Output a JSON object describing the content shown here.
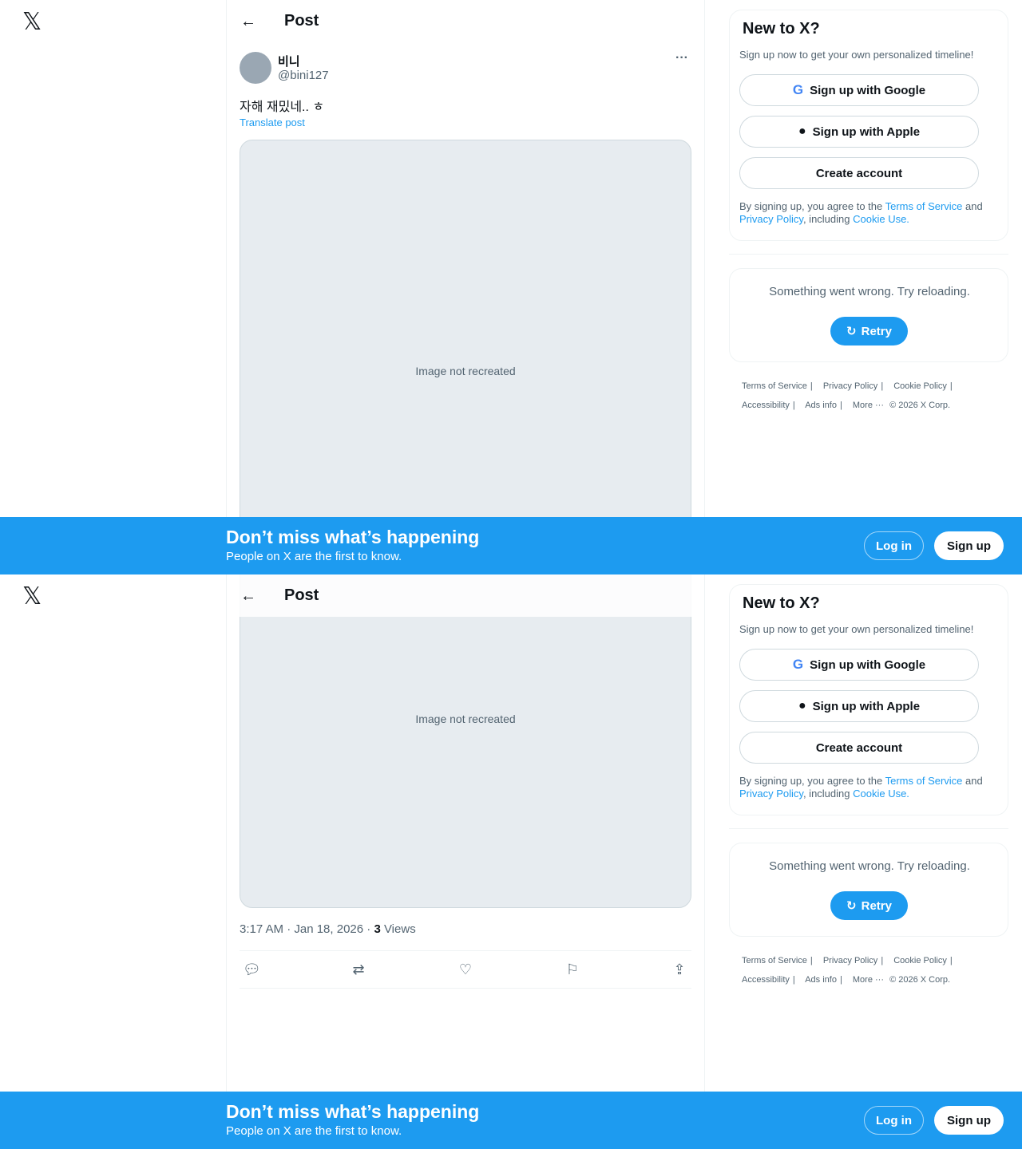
{
  "app": {
    "logo": "𝕏"
  },
  "header": {
    "back_icon": "arrow-left-icon",
    "title": "Post"
  },
  "post": {
    "author_name": "비니",
    "author_handle": "@bini127",
    "text": "자해 재밌네.. ㅎ",
    "translate": "Translate post",
    "media_note": "Image not recreated",
    "timestamp": "3:17 AM · Jan 18, 2026 · ",
    "views_count": "3",
    "views_label": " Views"
  },
  "signup": {
    "title": "New to X?",
    "subtitle": "Sign up now to get your own personalized timeline!",
    "google_label": "Sign up with Google",
    "apple_label": "Sign up with Apple",
    "create_label": "Create account",
    "legal_prefix": "By signing up, you agree to the ",
    "terms": "Terms of Service",
    "and": " and ",
    "privacy": "Privacy Policy",
    "including": ", including ",
    "cookie": "Cookie Use."
  },
  "error": {
    "message": "Something went wrong. Try reloading.",
    "retry_label": "Retry"
  },
  "footer": {
    "terms": "Terms of Service",
    "privacy": "Privacy Policy",
    "cookie": "Cookie Policy",
    "accessibility": "Accessibility",
    "ads": "Ads info",
    "more": "More ···",
    "copyright": "© 2026 X Corp."
  },
  "banner": {
    "title": "Don’t miss what’s happening",
    "subtitle": "People on X are the first to know.",
    "login_label": "Log in",
    "signup_label": "Sign up"
  },
  "colors": {
    "accent": "#1d9bf0",
    "text": "#0f1419",
    "muted": "#536471"
  }
}
